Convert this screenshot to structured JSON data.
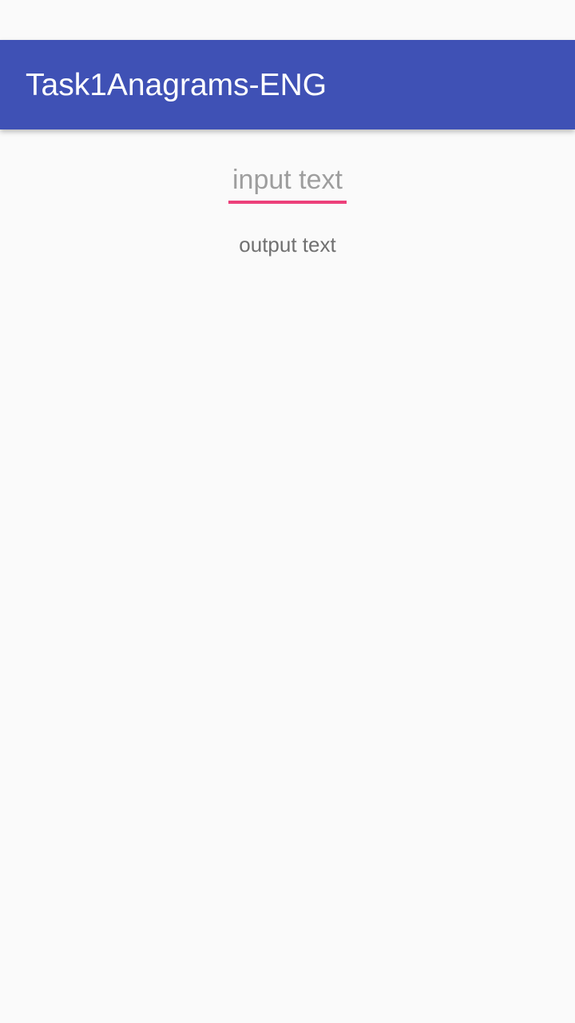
{
  "app_bar": {
    "title": "Task1Anagrams-ENG",
    "background_color": "#3f51b5"
  },
  "input": {
    "value": "",
    "placeholder": "input text",
    "accent_color": "#ec407a"
  },
  "output": {
    "text": "output text"
  }
}
